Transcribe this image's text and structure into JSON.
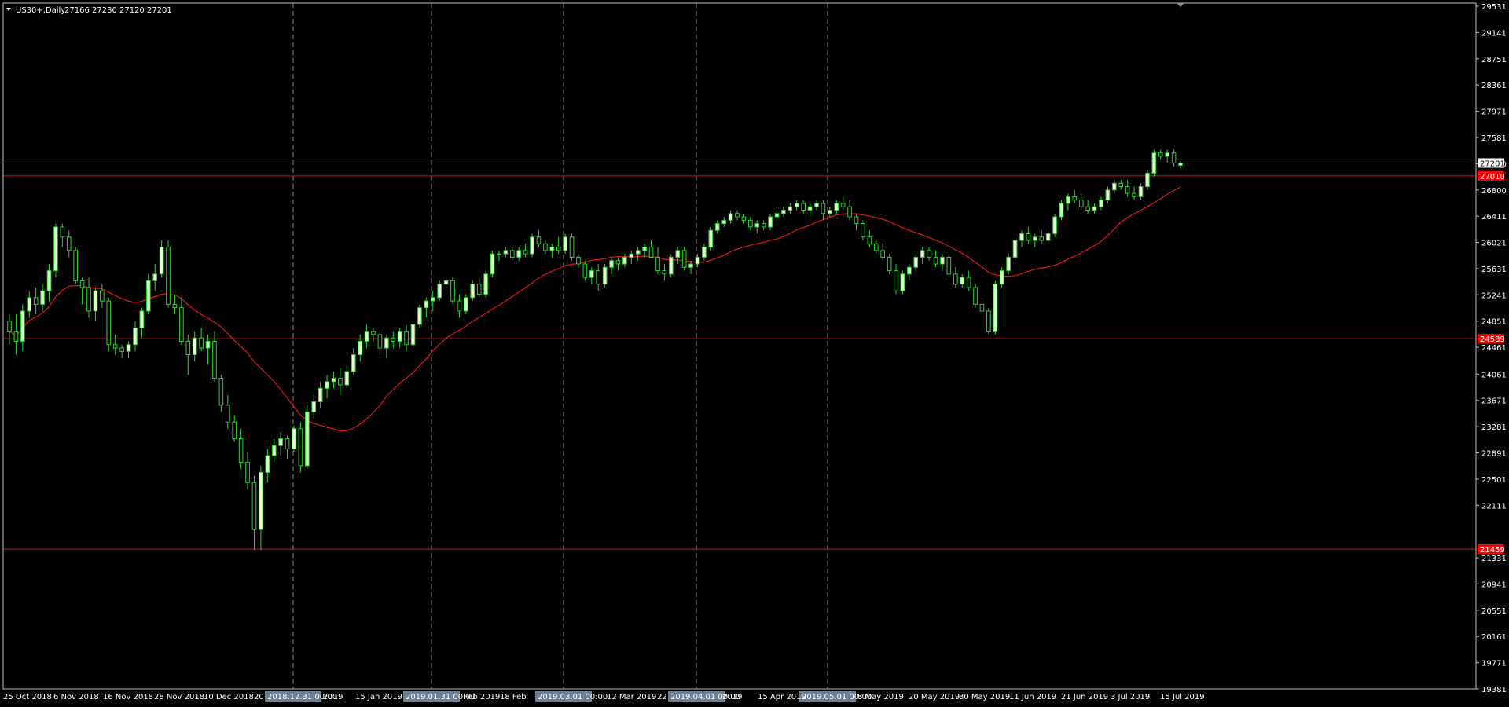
{
  "header": {
    "symbol": "US30+,Daily",
    "ohlc": "27166 27230 27120 27201"
  },
  "colors": {
    "background": "#000000",
    "frame": "#c0c0c0",
    "bull_body": "#e4ffd0",
    "bear_body": "#000000",
    "wick": "#2dd42d",
    "ma": "#e01818",
    "hline": "#e01818",
    "current_line": "#c0c0c0",
    "separator": "#8a8a8a",
    "tag_red": "#ff0000"
  },
  "chart_data": {
    "type": "candlestick",
    "symbol": "US30+",
    "timeframe": "Daily",
    "ylim": [
      19381,
      29531
    ],
    "y_ticks": [
      19381,
      19771,
      20161,
      20551,
      20941,
      21331,
      22111,
      22501,
      22891,
      23281,
      23671,
      24061,
      24461,
      24851,
      25241,
      25631,
      26021,
      26411,
      26800,
      27190,
      27581,
      27971,
      28361,
      28751,
      29141,
      29531
    ],
    "x_tick_labels": [
      "25 Oct 2018",
      "6 Nov 2018",
      "16 Nov 2018",
      "28 Nov 2018",
      "10 Dec 2018",
      "20",
      "2019",
      "15 Jan 2019",
      "Feb 2019",
      "18 Feb",
      "12 Mar 2019",
      "22",
      "2019",
      "15 Apr 2019",
      "8 May 2019",
      "20 May 2019",
      "30 May 2019",
      "11 Jun 2019",
      "21 Jun 2019",
      "3 Jul 2019",
      "15 Jul 2019"
    ],
    "period_separators": [
      "2018.12.31 00:00",
      "2019.01.31 00:00",
      "2019.03.01 00:00",
      "2019.04.01 00:00",
      "2019.05.01 00:00"
    ],
    "horizontal_lines": [
      {
        "price": 27010,
        "label": "27010"
      },
      {
        "price": 24589,
        "label": "24589"
      },
      {
        "price": 21459,
        "label": "21459"
      }
    ],
    "current_price": {
      "price": 27201,
      "label": "27201"
    },
    "moving_average": {
      "period": 20,
      "color": "#e01818"
    },
    "candles": [
      [
        24850,
        24950,
        24500,
        24700
      ],
      [
        24700,
        24950,
        24350,
        24550
      ],
      [
        24550,
        25100,
        24400,
        25000
      ],
      [
        25000,
        25300,
        24900,
        25200
      ],
      [
        25200,
        25350,
        24950,
        25100
      ],
      [
        25100,
        25400,
        25000,
        25300
      ],
      [
        25300,
        25700,
        25150,
        25600
      ],
      [
        25600,
        26300,
        25500,
        26250
      ],
      [
        26250,
        26300,
        25950,
        26100
      ],
      [
        26100,
        26200,
        25800,
        25900
      ],
      [
        25900,
        25950,
        25400,
        25450
      ],
      [
        25450,
        25500,
        25100,
        25350
      ],
      [
        25350,
        25500,
        24900,
        25000
      ],
      [
        25000,
        25350,
        24850,
        25300
      ],
      [
        25300,
        25400,
        25050,
        25150
      ],
      [
        25150,
        25200,
        24400,
        24500
      ],
      [
        24500,
        24650,
        24350,
        24450
      ],
      [
        24450,
        24500,
        24300,
        24400
      ],
      [
        24400,
        24550,
        24300,
        24500
      ],
      [
        24500,
        24850,
        24400,
        24750
      ],
      [
        24750,
        25050,
        24600,
        25000
      ],
      [
        25000,
        25550,
        24950,
        25450
      ],
      [
        25450,
        25700,
        25300,
        25550
      ],
      [
        25550,
        26050,
        25500,
        25950
      ],
      [
        25950,
        26050,
        25050,
        25100
      ],
      [
        25100,
        25250,
        24950,
        25050
      ],
      [
        25050,
        25200,
        24500,
        24550
      ],
      [
        24550,
        24650,
        24050,
        24350
      ],
      [
        24350,
        24700,
        24250,
        24600
      ],
      [
        24600,
        24750,
        24400,
        24450
      ],
      [
        24450,
        24650,
        24200,
        24550
      ],
      [
        24550,
        24700,
        23950,
        24000
      ],
      [
        24000,
        24050,
        23500,
        23600
      ],
      [
        23600,
        23750,
        23250,
        23350
      ],
      [
        23350,
        23450,
        23050,
        23100
      ],
      [
        23100,
        23250,
        22650,
        22750
      ],
      [
        22750,
        22900,
        22350,
        22450
      ],
      [
        22450,
        22550,
        21450,
        21750
      ],
      [
        21750,
        22700,
        21450,
        22600
      ],
      [
        22600,
        22950,
        22450,
        22850
      ],
      [
        22850,
        23100,
        22750,
        23000
      ],
      [
        23000,
        23200,
        22850,
        23100
      ],
      [
        23100,
        23150,
        22800,
        22950
      ],
      [
        22950,
        23300,
        22900,
        23250
      ],
      [
        23250,
        23350,
        22600,
        22700
      ],
      [
        22700,
        23600,
        22650,
        23500
      ],
      [
        23500,
        23750,
        23400,
        23650
      ],
      [
        23650,
        23950,
        23550,
        23850
      ],
      [
        23850,
        24050,
        23700,
        23950
      ],
      [
        23950,
        24100,
        23850,
        24000
      ],
      [
        24000,
        24150,
        23750,
        23900
      ],
      [
        23900,
        24200,
        23850,
        24100
      ],
      [
        24100,
        24450,
        24050,
        24350
      ],
      [
        24350,
        24650,
        24250,
        24550
      ],
      [
        24550,
        24800,
        24450,
        24700
      ],
      [
        24700,
        24750,
        24550,
        24650
      ],
      [
        24650,
        24700,
        24350,
        24450
      ],
      [
        24450,
        24650,
        24300,
        24600
      ],
      [
        24600,
        24700,
        24450,
        24550
      ],
      [
        24550,
        24750,
        24450,
        24700
      ],
      [
        24700,
        24800,
        24400,
        24500
      ],
      [
        24500,
        24850,
        24450,
        24800
      ],
      [
        24800,
        25100,
        24750,
        25050
      ],
      [
        25050,
        25200,
        24900,
        25150
      ],
      [
        25150,
        25300,
        25000,
        25200
      ],
      [
        25200,
        25450,
        25150,
        25400
      ],
      [
        25400,
        25500,
        25250,
        25450
      ],
      [
        25450,
        25500,
        25100,
        25150
      ],
      [
        25150,
        25250,
        24900,
        25000
      ],
      [
        25000,
        25250,
        24950,
        25200
      ],
      [
        25200,
        25450,
        25150,
        25400
      ],
      [
        25400,
        25500,
        25200,
        25250
      ],
      [
        25250,
        25600,
        25200,
        25550
      ],
      [
        25550,
        25900,
        25500,
        25850
      ],
      [
        25850,
        25900,
        25750,
        25850
      ],
      [
        25850,
        25950,
        25800,
        25900
      ],
      [
        25900,
        25950,
        25750,
        25800
      ],
      [
        25800,
        25950,
        25750,
        25900
      ],
      [
        25900,
        26000,
        25800,
        25850
      ],
      [
        25850,
        26150,
        25800,
        26100
      ],
      [
        26100,
        26200,
        25950,
        26000
      ],
      [
        26000,
        26050,
        25850,
        25900
      ],
      [
        25900,
        26000,
        25800,
        25950
      ],
      [
        25950,
        26100,
        25850,
        25900
      ],
      [
        25900,
        26150,
        25850,
        26100
      ],
      [
        26100,
        26150,
        25750,
        25800
      ],
      [
        25800,
        25850,
        25650,
        25700
      ],
      [
        25700,
        25750,
        25450,
        25500
      ],
      [
        25500,
        25650,
        25400,
        25600
      ],
      [
        25600,
        25700,
        25300,
        25400
      ],
      [
        25400,
        25700,
        25350,
        25650
      ],
      [
        25650,
        25800,
        25550,
        25750
      ],
      [
        25750,
        25800,
        25600,
        25700
      ],
      [
        25700,
        25850,
        25650,
        25800
      ],
      [
        25800,
        25900,
        25700,
        25850
      ],
      [
        25850,
        25950,
        25750,
        25900
      ],
      [
        25900,
        26000,
        25800,
        25950
      ],
      [
        25950,
        26050,
        25850,
        25800
      ],
      [
        25800,
        25950,
        25550,
        25600
      ],
      [
        25600,
        25700,
        25450,
        25550
      ],
      [
        25550,
        25850,
        25500,
        25800
      ],
      [
        25800,
        25950,
        25700,
        25900
      ],
      [
        25900,
        25950,
        25600,
        25650
      ],
      [
        25650,
        25750,
        25550,
        25700
      ],
      [
        25700,
        25850,
        25650,
        25800
      ],
      [
        25800,
        26000,
        25750,
        25950
      ],
      [
        25950,
        26250,
        25900,
        26200
      ],
      [
        26200,
        26350,
        26150,
        26300
      ],
      [
        26300,
        26400,
        26250,
        26350
      ],
      [
        26350,
        26500,
        26300,
        26450
      ],
      [
        26450,
        26500,
        26350,
        26400
      ],
      [
        26400,
        26450,
        26300,
        26350
      ],
      [
        26350,
        26400,
        26200,
        26250
      ],
      [
        26250,
        26350,
        26150,
        26300
      ],
      [
        26300,
        26350,
        26200,
        26250
      ],
      [
        26250,
        26450,
        26200,
        26400
      ],
      [
        26400,
        26500,
        26350,
        26450
      ],
      [
        26450,
        26550,
        26400,
        26500
      ],
      [
        26500,
        26600,
        26450,
        26550
      ],
      [
        26550,
        26650,
        26500,
        26600
      ],
      [
        26600,
        26650,
        26450,
        26500
      ],
      [
        26500,
        26600,
        26400,
        26550
      ],
      [
        26550,
        26650,
        26500,
        26600
      ],
      [
        26600,
        26650,
        26350,
        26450
      ],
      [
        26450,
        26550,
        26400,
        26500
      ],
      [
        26500,
        26650,
        26450,
        26600
      ],
      [
        26600,
        26700,
        26500,
        26550
      ],
      [
        26550,
        26650,
        26350,
        26400
      ],
      [
        26400,
        26450,
        26200,
        26300
      ],
      [
        26300,
        26350,
        26050,
        26100
      ],
      [
        26100,
        26200,
        25950,
        26000
      ],
      [
        26000,
        26050,
        25850,
        25900
      ],
      [
        25900,
        26000,
        25750,
        25800
      ],
      [
        25800,
        25850,
        25550,
        25600
      ],
      [
        25600,
        25700,
        25250,
        25300
      ],
      [
        25300,
        25600,
        25250,
        25550
      ],
      [
        25550,
        25700,
        25450,
        25650
      ],
      [
        25650,
        25850,
        25600,
        25800
      ],
      [
        25800,
        25950,
        25700,
        25900
      ],
      [
        25900,
        25950,
        25750,
        25800
      ],
      [
        25800,
        25900,
        25650,
        25700
      ],
      [
        25700,
        25850,
        25600,
        25800
      ],
      [
        25800,
        25850,
        25500,
        25550
      ],
      [
        25550,
        25650,
        25350,
        25400
      ],
      [
        25400,
        25550,
        25350,
        25500
      ],
      [
        25500,
        25600,
        25300,
        25350
      ],
      [
        25350,
        25400,
        25050,
        25100
      ],
      [
        25100,
        25200,
        24950,
        25000
      ],
      [
        25000,
        25050,
        24650,
        24700
      ],
      [
        24700,
        25450,
        24650,
        25400
      ],
      [
        25400,
        25650,
        25350,
        25600
      ],
      [
        25600,
        25850,
        25550,
        25800
      ],
      [
        25800,
        26100,
        25750,
        26050
      ],
      [
        26050,
        26200,
        25950,
        26150
      ],
      [
        26150,
        26250,
        26000,
        26050
      ],
      [
        26050,
        26150,
        25950,
        26100
      ],
      [
        26100,
        26200,
        26000,
        26050
      ],
      [
        26050,
        26200,
        26000,
        26150
      ],
      [
        26150,
        26450,
        26100,
        26400
      ],
      [
        26400,
        26650,
        26350,
        26600
      ],
      [
        26600,
        26750,
        26500,
        26700
      ],
      [
        26700,
        26800,
        26600,
        26650
      ],
      [
        26650,
        26750,
        26500,
        26550
      ],
      [
        26550,
        26650,
        26450,
        26500
      ],
      [
        26500,
        26600,
        26450,
        26550
      ],
      [
        26550,
        26700,
        26500,
        26650
      ],
      [
        26650,
        26850,
        26600,
        26800
      ],
      [
        26800,
        26950,
        26750,
        26900
      ],
      [
        26900,
        26950,
        26800,
        26850
      ],
      [
        26850,
        26950,
        26700,
        26750
      ],
      [
        26750,
        26850,
        26650,
        26700
      ],
      [
        26700,
        26900,
        26650,
        26850
      ],
      [
        26850,
        27100,
        26800,
        27050
      ],
      [
        27050,
        27400,
        27000,
        27350
      ],
      [
        27350,
        27400,
        27250,
        27300
      ],
      [
        27300,
        27400,
        27200,
        27350
      ],
      [
        27350,
        27400,
        27150,
        27200
      ],
      [
        27166,
        27230,
        27120,
        27201
      ]
    ]
  }
}
